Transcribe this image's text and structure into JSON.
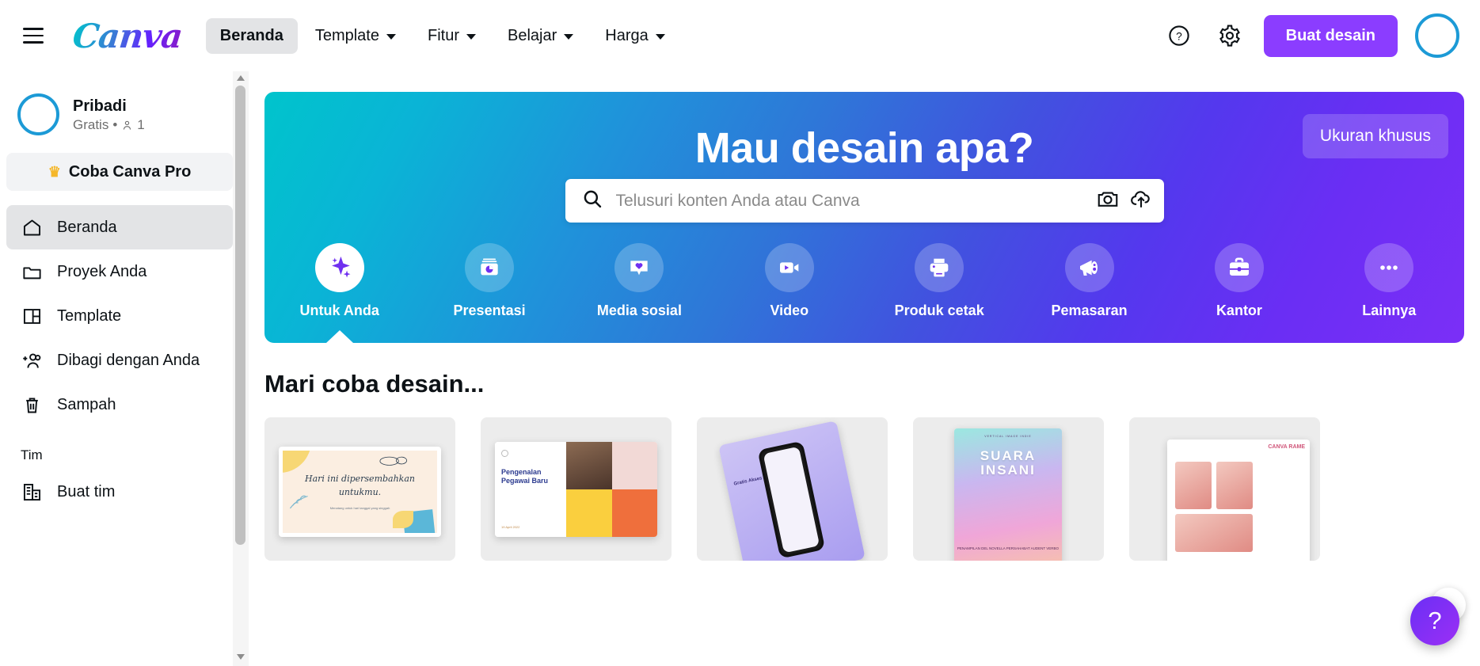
{
  "header": {
    "menu_icon": "hamburger-icon",
    "logo_text": "Canva",
    "nav": [
      {
        "label": "Beranda",
        "has_caret": false,
        "active": true
      },
      {
        "label": "Template",
        "has_caret": true,
        "active": false
      },
      {
        "label": "Fitur",
        "has_caret": true,
        "active": false
      },
      {
        "label": "Belajar",
        "has_caret": true,
        "active": false
      },
      {
        "label": "Harga",
        "has_caret": true,
        "active": false
      }
    ],
    "help_icon": "question-circle-icon",
    "settings_icon": "gear-icon",
    "create_button": "Buat desain",
    "avatar": "avatar"
  },
  "sidebar": {
    "profile": {
      "name": "Pribadi",
      "plan": "Gratis",
      "separator": "•",
      "member_count": "1"
    },
    "pro_banner": {
      "label": "Coba Canva Pro",
      "icon": "crown-icon"
    },
    "items": [
      {
        "label": "Beranda",
        "icon": "home-icon",
        "active": true
      },
      {
        "label": "Proyek Anda",
        "icon": "folder-icon",
        "active": false
      },
      {
        "label": "Template",
        "icon": "layout-icon",
        "active": false
      },
      {
        "label": "Dibagi dengan Anda",
        "icon": "add-people-icon",
        "active": false
      },
      {
        "label": "Sampah",
        "icon": "trash-icon",
        "active": false
      }
    ],
    "team_section_label": "Tim",
    "team_items": [
      {
        "label": "Buat tim",
        "icon": "building-icon"
      }
    ]
  },
  "hero": {
    "title": "Mau desain apa?",
    "custom_size_button": "Ukuran khusus",
    "search": {
      "placeholder": "Telusuri konten Anda atau Canva",
      "value": "",
      "search_icon": "search-icon",
      "camera_icon": "camera-icon",
      "upload_icon": "cloud-upload-icon"
    },
    "categories": [
      {
        "label": "Untuk Anda",
        "icon": "sparkle-icon",
        "active": true
      },
      {
        "label": "Presentasi",
        "icon": "presentation-icon",
        "active": false
      },
      {
        "label": "Media sosial",
        "icon": "heart-bubble-icon",
        "active": false
      },
      {
        "label": "Video",
        "icon": "video-camera-icon",
        "active": false
      },
      {
        "label": "Produk cetak",
        "icon": "printer-icon",
        "active": false
      },
      {
        "label": "Pemasaran",
        "icon": "megaphone-icon",
        "active": false
      },
      {
        "label": "Kantor",
        "icon": "briefcase-icon",
        "active": false
      },
      {
        "label": "Lainnya",
        "icon": "more-dots-icon",
        "active": false
      }
    ]
  },
  "main": {
    "section_title": "Mari coba desain...",
    "next_button_icon": "chevron-right-icon",
    "cards": [
      {
        "name": "card-hari-ini",
        "line1": "Hari ini dipersembahkan",
        "line2": "untukmu.",
        "caption": "Menatang untuk hari tanggal yang singgah"
      },
      {
        "name": "card-pengenalan-pegawai",
        "title": "Pengenalan Pegawai Baru",
        "date": "19 April 2022"
      },
      {
        "name": "card-gratis-akses",
        "text": "Gratis Akses Dua Minggu"
      },
      {
        "name": "card-suara-insani",
        "kicker": "VERTICAL IMAGE INDIE",
        "title": "SUARA INSANI",
        "footer": "PENAMPILAN\nDEL NOVELLA\nPERSAHABAT\nAUDENT VERBO"
      },
      {
        "name": "card-canva-rame",
        "text": "CANVA RAME"
      }
    ]
  },
  "help_fab": {
    "label": "?"
  }
}
